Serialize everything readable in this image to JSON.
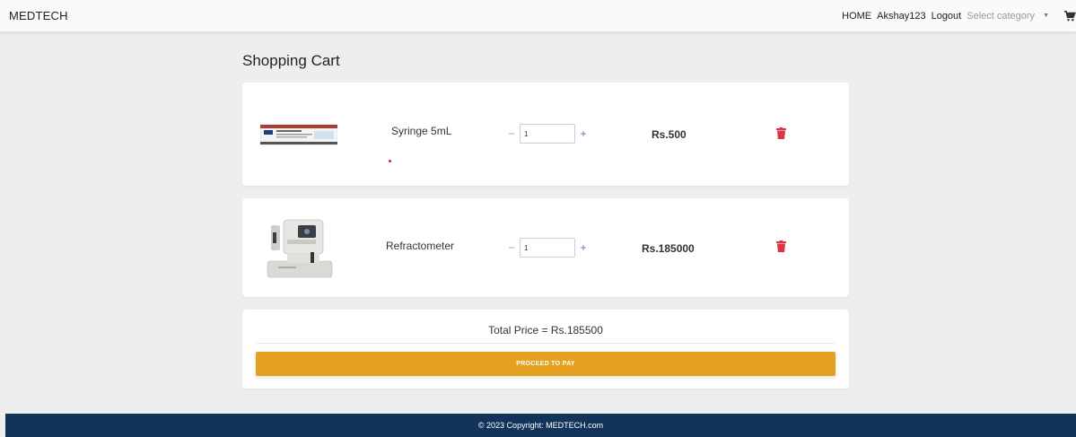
{
  "navbar": {
    "brand": "MEDTECH",
    "home": "HOME",
    "username": "Akshay123",
    "logout": "Logout",
    "category_select": "Select category",
    "cart_icon": "cart-icon"
  },
  "page": {
    "title": "Shopping Cart"
  },
  "cart": {
    "items": [
      {
        "name": "Syringe 5mL",
        "quantity": "1",
        "price": "Rs.500",
        "image_icon": "syringe-box-image",
        "delete_icon": "trash-icon",
        "minus": "−",
        "plus": "+"
      },
      {
        "name": "Refractometer",
        "quantity": "1",
        "price": "Rs.185000",
        "image_icon": "refractometer-image",
        "delete_icon": "trash-icon",
        "minus": "−",
        "plus": "+"
      }
    ],
    "total": "Total Price = Rs.185500",
    "checkout_label": "PROCEED TO PAY"
  },
  "footer": {
    "copyright": "© 2023 Copyright: MEDTECH.com"
  },
  "colors": {
    "accent": "#e3a11f",
    "footer_bg": "#12345a",
    "delete": "#dc3545"
  }
}
